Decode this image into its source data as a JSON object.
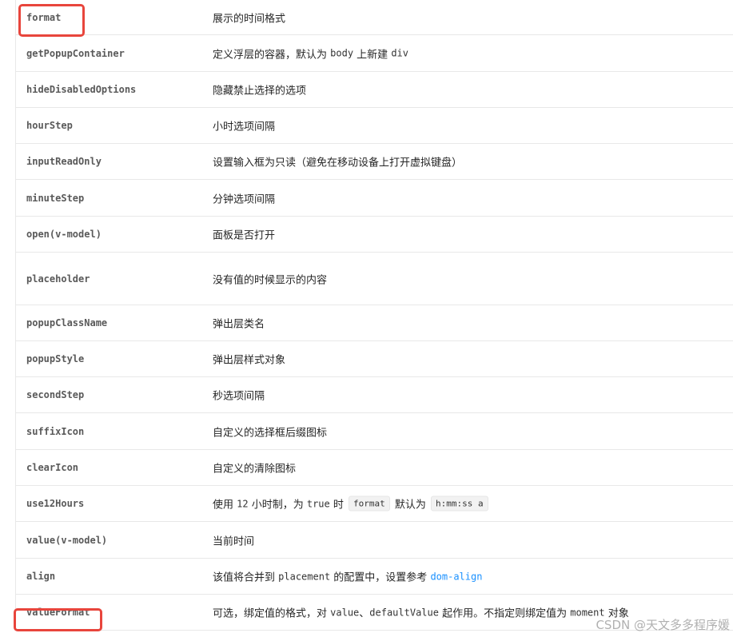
{
  "rows": [
    {
      "prop": "format",
      "desc": [
        {
          "t": "text",
          "v": "展示的时间格式"
        }
      ]
    },
    {
      "prop": "getPopupContainer",
      "desc": [
        {
          "t": "text",
          "v": "定义浮层的容器，默认为 "
        },
        {
          "t": "mono",
          "v": "body"
        },
        {
          "t": "text",
          "v": " 上新建 "
        },
        {
          "t": "mono",
          "v": "div"
        }
      ]
    },
    {
      "prop": "hideDisabledOptions",
      "desc": [
        {
          "t": "text",
          "v": "隐藏禁止选择的选项"
        }
      ]
    },
    {
      "prop": "hourStep",
      "desc": [
        {
          "t": "text",
          "v": "小时选项间隔"
        }
      ]
    },
    {
      "prop": "inputReadOnly",
      "desc": [
        {
          "t": "text",
          "v": "设置输入框为只读（避免在移动设备上打开虚拟键盘）"
        }
      ]
    },
    {
      "prop": "minuteStep",
      "desc": [
        {
          "t": "text",
          "v": "分钟选项间隔"
        }
      ]
    },
    {
      "prop": "open(v-model)",
      "desc": [
        {
          "t": "text",
          "v": "面板是否打开"
        }
      ]
    },
    {
      "prop": "placeholder",
      "desc": [
        {
          "t": "text",
          "v": "没有值的时候显示的内容"
        }
      ]
    },
    {
      "prop": "popupClassName",
      "desc": [
        {
          "t": "text",
          "v": "弹出层类名"
        }
      ]
    },
    {
      "prop": "popupStyle",
      "desc": [
        {
          "t": "text",
          "v": "弹出层样式对象"
        }
      ]
    },
    {
      "prop": "secondStep",
      "desc": [
        {
          "t": "text",
          "v": "秒选项间隔"
        }
      ]
    },
    {
      "prop": "suffixIcon",
      "desc": [
        {
          "t": "text",
          "v": "自定义的选择框后缀图标"
        }
      ]
    },
    {
      "prop": "clearIcon",
      "desc": [
        {
          "t": "text",
          "v": "自定义的清除图标"
        }
      ]
    },
    {
      "prop": "use12Hours",
      "desc": [
        {
          "t": "text",
          "v": "使用 "
        },
        {
          "t": "mono",
          "v": "12"
        },
        {
          "t": "text",
          "v": " 小时制，为 "
        },
        {
          "t": "mono",
          "v": "true"
        },
        {
          "t": "text",
          "v": " 时 "
        },
        {
          "t": "code",
          "v": "format"
        },
        {
          "t": "text",
          "v": " 默认为 "
        },
        {
          "t": "code",
          "v": "h:mm:ss a"
        }
      ]
    },
    {
      "prop": "value(v-model)",
      "desc": [
        {
          "t": "text",
          "v": "当前时间"
        }
      ]
    },
    {
      "prop": "align",
      "desc": [
        {
          "t": "text",
          "v": "该值将合并到 "
        },
        {
          "t": "mono",
          "v": "placement"
        },
        {
          "t": "text",
          "v": " 的配置中，设置参考 "
        },
        {
          "t": "link",
          "v": "dom-align"
        }
      ]
    },
    {
      "prop": "valueFormat",
      "desc": [
        {
          "t": "text",
          "v": "可选，绑定值的格式，对 "
        },
        {
          "t": "mono",
          "v": "value"
        },
        {
          "t": "text",
          "v": "、"
        },
        {
          "t": "mono",
          "v": "defaultValue"
        },
        {
          "t": "text",
          "v": " 起作用。不指定则绑定值为 "
        },
        {
          "t": "mono",
          "v": "moment"
        },
        {
          "t": "text",
          "v": " 对象"
        }
      ]
    }
  ],
  "highlighted": [
    "format",
    "valueFormat"
  ],
  "colors": {
    "highlight": "#e8453c",
    "link": "#1890ff",
    "border": "#e8e8e8"
  },
  "watermark": "CSDN @天文多多程序媛"
}
